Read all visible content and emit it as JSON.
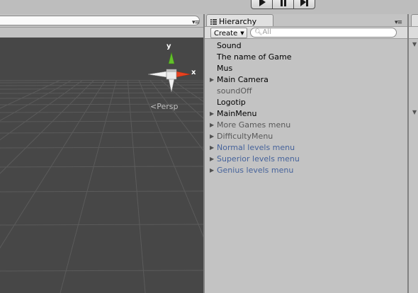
{
  "toolbar": {
    "play_icon": "play-icon",
    "pause_icon": "pause-icon",
    "step_icon": "step-icon"
  },
  "scene": {
    "camera_mode": "Persp",
    "gizmo": {
      "y_label": "y",
      "x_label": "x"
    },
    "colors": {
      "background": "#474747",
      "grid": "#5a5a5a",
      "x_axis": "#e8411f",
      "y_axis": "#62c12a"
    }
  },
  "hierarchy": {
    "tab_title": "Hierarchy",
    "create_label": "Create",
    "search_placeholder": "All",
    "items": [
      {
        "label": "Sound",
        "has_children": false,
        "style": "black"
      },
      {
        "label": "The name of Game",
        "has_children": false,
        "style": "black"
      },
      {
        "label": "Mus",
        "has_children": false,
        "style": "black"
      },
      {
        "label": "Main Camera",
        "has_children": true,
        "style": "black"
      },
      {
        "label": "soundOff",
        "has_children": false,
        "style": "gray"
      },
      {
        "label": "Logotip",
        "has_children": false,
        "style": "black"
      },
      {
        "label": "MainMenu",
        "has_children": true,
        "style": "black"
      },
      {
        "label": "More Games menu",
        "has_children": true,
        "style": "gray"
      },
      {
        "label": "DifficultyMenu",
        "has_children": true,
        "style": "gray"
      },
      {
        "label": "Normal levels menu",
        "has_children": true,
        "style": "blue"
      },
      {
        "label": "Superior levels menu",
        "has_children": true,
        "style": "blue"
      },
      {
        "label": "Genius levels menu",
        "has_children": true,
        "style": "blue"
      }
    ],
    "colors": {
      "black": "#000000",
      "gray": "#585858",
      "blue": "#46639b"
    }
  }
}
